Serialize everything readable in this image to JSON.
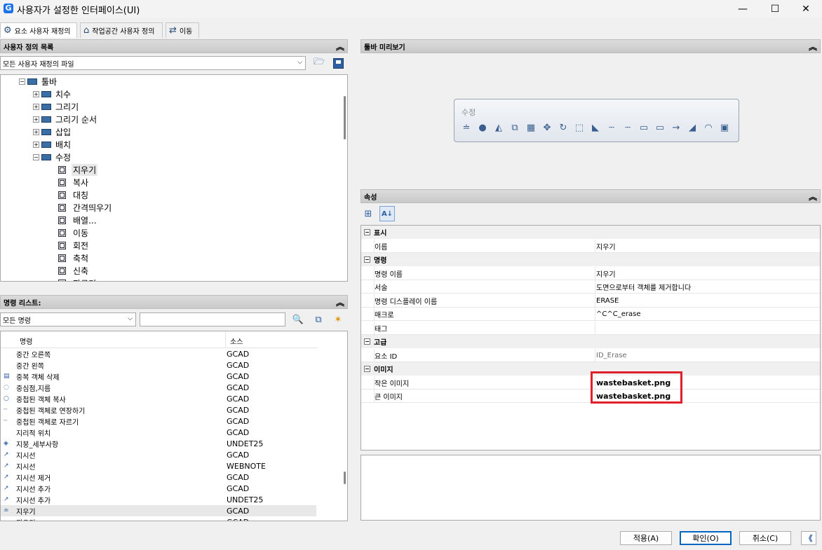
{
  "window": {
    "title": "사용자가 설정한 인터페이스(UI)",
    "minimize": "—",
    "maximize": "☐",
    "close": "✕"
  },
  "tabs": [
    {
      "label": "요소 사용자 재정의",
      "icon": "gear-icon"
    },
    {
      "label": "작업공간 사용자 정의",
      "icon": "house-icon"
    },
    {
      "label": "이동",
      "icon": "swap-arrows-icon"
    }
  ],
  "left_top": {
    "header": "사용자 정의 목록",
    "combo_value": "모든 사용자 재정의 파일",
    "tree": [
      {
        "label": "툴바",
        "level": 0,
        "expanded": true
      },
      {
        "label": "치수",
        "level": 1,
        "expanded": false
      },
      {
        "label": "그리기",
        "level": 1,
        "expanded": false
      },
      {
        "label": "그리기 순서",
        "level": 1,
        "expanded": false
      },
      {
        "label": "삽입",
        "level": 1,
        "expanded": false
      },
      {
        "label": "배치",
        "level": 1,
        "expanded": false
      },
      {
        "label": "수정",
        "level": 1,
        "expanded": true
      },
      {
        "label": "지우기",
        "level": 2,
        "selected": true
      },
      {
        "label": "복사",
        "level": 2
      },
      {
        "label": "대칭",
        "level": 2
      },
      {
        "label": "간격띄우기",
        "level": 2
      },
      {
        "label": "배열...",
        "level": 2
      },
      {
        "label": "이동",
        "level": 2
      },
      {
        "label": "회전",
        "level": 2
      },
      {
        "label": "축척",
        "level": 2
      },
      {
        "label": "신축",
        "level": 2
      },
      {
        "label": "자르기",
        "level": 2
      }
    ]
  },
  "left_bottom": {
    "header": "명령 리스트:",
    "combo_value": "모든 명령",
    "search_value": "",
    "columns": [
      "명령",
      "소스"
    ],
    "rows": [
      {
        "name": "중간 오른쪽",
        "source": "GCAD",
        "icon": ""
      },
      {
        "name": "중간 왼쪽",
        "source": "GCAD",
        "icon": ""
      },
      {
        "name": "중복 객체 삭제",
        "source": "GCAD",
        "icon": "▤"
      },
      {
        "name": "중심점,지름",
        "source": "GCAD",
        "icon": "◌"
      },
      {
        "name": "중첩된 객체 복사",
        "source": "GCAD",
        "icon": "○"
      },
      {
        "name": "중첩된 객체로 연장하기",
        "source": "GCAD",
        "icon": "┈"
      },
      {
        "name": "중첩된 객체로 자르기",
        "source": "GCAD",
        "icon": "┈"
      },
      {
        "name": "지리적 위치",
        "source": "GCAD",
        "icon": ""
      },
      {
        "name": "지붕_세부사항",
        "source": "UNDET25",
        "icon": "◈"
      },
      {
        "name": "지시선",
        "source": "GCAD",
        "icon": "↗"
      },
      {
        "name": "지시선",
        "source": "WEBNOTE",
        "icon": "↗"
      },
      {
        "name": "지시선 제거",
        "source": "GCAD",
        "icon": "↗"
      },
      {
        "name": "지시선 추가",
        "source": "GCAD",
        "icon": "↗"
      },
      {
        "name": "지시선 추가",
        "source": "UNDET25",
        "icon": "↗"
      },
      {
        "name": "지우기",
        "source": "GCAD",
        "icon": "≐",
        "selected": true
      },
      {
        "name": "지우기",
        "source": "GCAD",
        "icon": "▭"
      }
    ]
  },
  "right_top": {
    "header": "툴바 미리보기",
    "toolbar_title": "수정",
    "toolbar_icons": [
      "≐",
      "●",
      "◭",
      "⧉",
      "▦",
      "✥",
      "↻",
      "⬚",
      "◣",
      "┄",
      "┄",
      "▭",
      "▭",
      "→",
      "◢",
      "◠",
      "▣"
    ]
  },
  "properties": {
    "header": "속성",
    "sections": [
      {
        "title": "표시",
        "rows": [
          {
            "key": "이름",
            "value": "지우기"
          }
        ]
      },
      {
        "title": "명령",
        "rows": [
          {
            "key": "명령 이름",
            "value": "지우기"
          },
          {
            "key": "서술",
            "value": "도면으로부터 객체를 제거합니다"
          },
          {
            "key": "명령 디스플레이 이름",
            "value": "ERASE"
          },
          {
            "key": "매크로",
            "value": "^C^C_erase"
          },
          {
            "key": "태그",
            "value": ""
          }
        ]
      },
      {
        "title": "고급",
        "rows": [
          {
            "key": "요소 ID",
            "value": "ID_Erase"
          }
        ]
      },
      {
        "title": "이미지",
        "rows": [
          {
            "key": "작은 이미지",
            "value": "wastebasket.png"
          },
          {
            "key": "큰 이미지",
            "value": "wastebasket.png"
          }
        ]
      }
    ]
  },
  "buttons": {
    "apply": "적용(A)",
    "ok": "확인(O)",
    "cancel": "취소(C)",
    "collapse": "《"
  },
  "colors": {
    "highlight_box": "#e0202a",
    "brand": "#1a73e8"
  }
}
